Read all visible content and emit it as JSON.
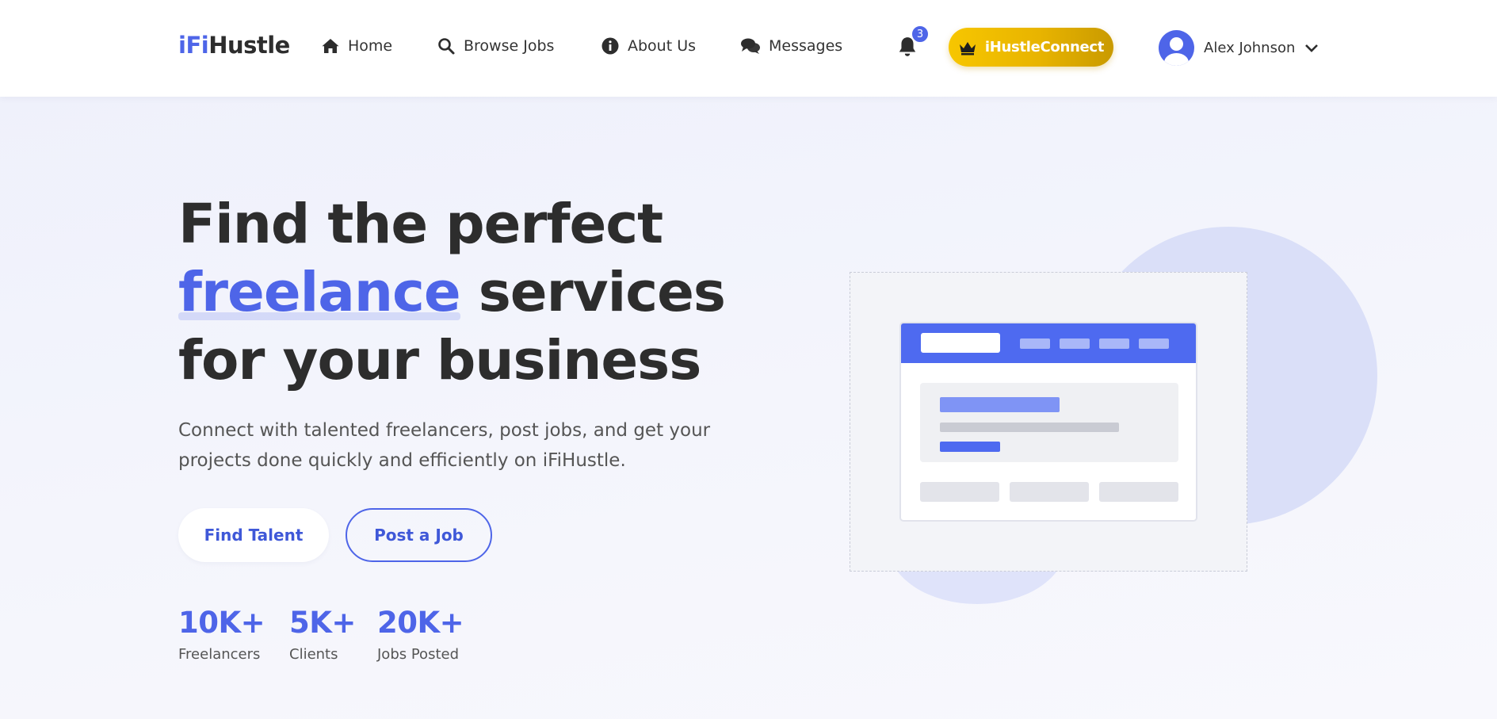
{
  "brand": {
    "logo_prefix": "iFi",
    "logo_suffix": "Hustle",
    "accent_color": "#4e65e8",
    "gold_color": "#f2c200"
  },
  "nav": {
    "items": [
      {
        "label": "Home",
        "icon": "home-icon"
      },
      {
        "label": "Browse Jobs",
        "icon": "search-icon"
      },
      {
        "label": "About Us",
        "icon": "info-icon"
      },
      {
        "label": "Messages",
        "icon": "chat-icon"
      }
    ],
    "notifications_count": "3",
    "connect_label": "iHustleConnect",
    "user_name": "Alex Johnson"
  },
  "hero": {
    "title_line1": "Find the perfect",
    "title_highlight": "freelance",
    "title_line2_rest": " services",
    "title_line3": "for your business",
    "subtitle": "Connect with talented freelancers, post jobs, and get your projects done quickly and efficiently on iFiHustle.",
    "primary_cta": "Find Talent",
    "secondary_cta": "Post a Job"
  },
  "stats": [
    {
      "value": "10K+",
      "label": "Freelancers"
    },
    {
      "value": "5K+",
      "label": "Clients"
    },
    {
      "value": "20K+",
      "label": "Jobs Posted"
    }
  ]
}
